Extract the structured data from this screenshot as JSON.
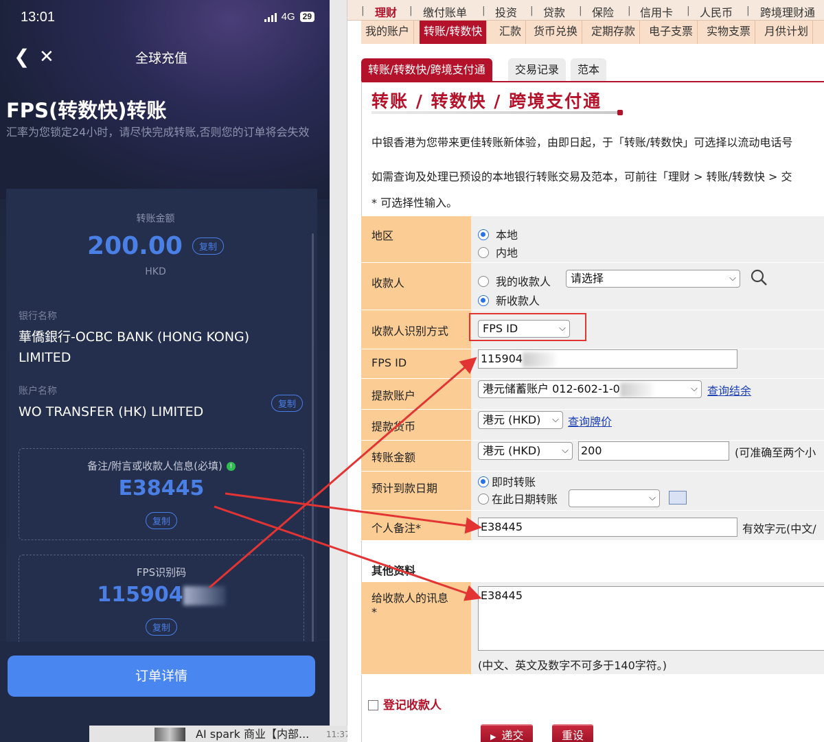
{
  "phone": {
    "status": {
      "time": "13:01",
      "network": "4G",
      "battery": "29"
    },
    "nav": {
      "title": "全球充值"
    },
    "header": {
      "title": "FPS(转数快)转账",
      "subtitle": "汇率为您锁定24小时，请尽快完成转账,否则您的订单将会失效"
    },
    "amount": {
      "label": "转账金额",
      "value": "200.00",
      "currency": "HKD",
      "copy": "复制"
    },
    "bank": {
      "label": "银行名称",
      "value": "華僑銀行-OCBC BANK (HONG KONG) LIMITED"
    },
    "account": {
      "label": "账户名称",
      "value": "WO TRANSFER (HK) LIMITED",
      "copy": "复制"
    },
    "remark": {
      "label": "备注/附言或收款人信息(必填)",
      "value": "E38445",
      "copy": "复制",
      "badge": "!"
    },
    "fps": {
      "label": "FPS识别码",
      "value": "115904",
      "copy": "复制"
    },
    "order_button": "订单详情"
  },
  "taskbar": {
    "text": "AI spark 商业【内部...",
    "time": "11:37"
  },
  "bank": {
    "menu_top": [
      "理财",
      "缴付账单",
      "投资",
      "贷款",
      "保险",
      "信用卡",
      "人民币",
      "跨境理财通"
    ],
    "menu_sub": [
      "我的账户",
      "转账/转数快",
      "汇款",
      "货币兑换",
      "定期存款",
      "电子支票",
      "实物支票",
      "月供计划"
    ],
    "tabs": [
      "转账/转数快/跨境支付通",
      "交易记录",
      "范本"
    ],
    "page_title": "转账 / 转数快 / 跨境支付通",
    "intro1": "中银香港为您带来更佳转账新体验，由即日起，于「转账/转数快」可选择以流动电话号",
    "intro2": "如需查询及处理已预设的本地银行转账交易及范本，可前往「理财 > 转账/转数快 > 交",
    "optional_note": "* 可选择性输入。",
    "form": {
      "region": {
        "label": "地区",
        "opt1": "本地",
        "opt2": "内地"
      },
      "payee": {
        "label": "收款人",
        "opt1": "我的收款人",
        "select": "请选择",
        "opt2": "新收款人"
      },
      "id_method": {
        "label": "收款人识别方式",
        "value": "FPS ID"
      },
      "fps_id": {
        "label": "FPS ID",
        "value": "115904"
      },
      "debit_account": {
        "label": "提款账户",
        "value": "港元储蓄账户 012-602-1-0",
        "link": "查询结余"
      },
      "debit_currency": {
        "label": "提款货币",
        "value": "港元 (HKD)",
        "link": "查询牌价"
      },
      "amount": {
        "label": "转账金额",
        "currency": "港元 (HKD)",
        "value": "200",
        "note": "(可准确至两个小"
      },
      "date": {
        "label": "预计到款日期",
        "opt1": "即时转账",
        "opt2": "在此日期转账"
      },
      "memo": {
        "label": "个人备注*",
        "value": "E38445",
        "note": "有效字元(中文/"
      },
      "other_section": "其他资料",
      "message": {
        "label": "给收款人的讯息",
        "star": "*",
        "value": "E38445",
        "note": "(中文、英文及数字不可多于140字符。)"
      },
      "register": "登记收款人"
    },
    "buttons": {
      "submit": "递交",
      "reset": "重设"
    }
  },
  "colors": {
    "bank_red": "#b3122a",
    "label_orange": "#fbcd94",
    "phone_blue": "#4a7fe6",
    "arrow_red": "#e33434"
  }
}
